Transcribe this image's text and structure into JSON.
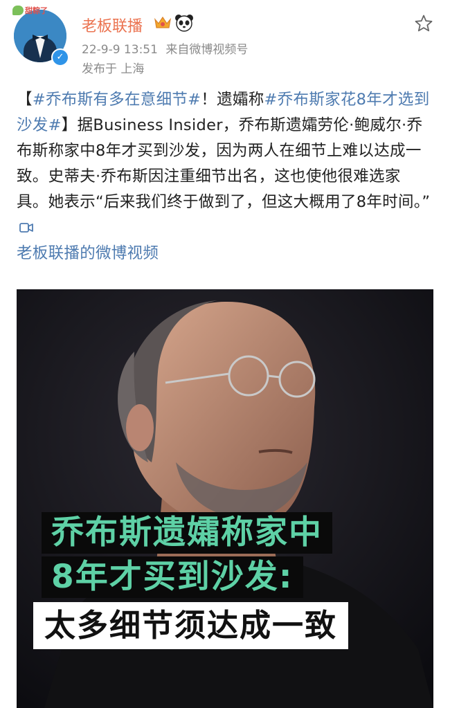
{
  "header": {
    "avatar_badge": "甜粽了",
    "username": "老板联播",
    "timestamp": "22-9-9 13:51",
    "source_prefix": "来自",
    "source": "微博视频号",
    "location": "发布于 上海"
  },
  "post": {
    "open_bracket": "【",
    "tag1": "#乔布斯有多在意细节#",
    "text1": "！遗孀称",
    "tag2": "#乔布斯家花8年才选到沙发#",
    "text2": "】据Business Insider，乔布斯遗孀劳伦·鲍威尔·乔布斯称家中8年才买到沙发，因为两人在细节上难以达成一致。史蒂夫·乔布斯因注重细节出名，这也使他很难选家具。她表示“后来我们终于做到了，但这大概用了8年时间。”",
    "video_link": "老板联播的微博视频"
  },
  "video": {
    "caption_line1": "乔布斯遗孀称家中",
    "caption_line2": "8年才买到沙发:",
    "caption_line3": "太多细节须达成一致"
  },
  "colors": {
    "username": "#eb7350",
    "link": "#4e7bb0",
    "meta": "#8a8a8a",
    "caption_green": "#5ed1a6"
  },
  "icons": [
    "star-icon",
    "crown-icon",
    "panda-icon",
    "verified-icon",
    "video-link-icon"
  ]
}
